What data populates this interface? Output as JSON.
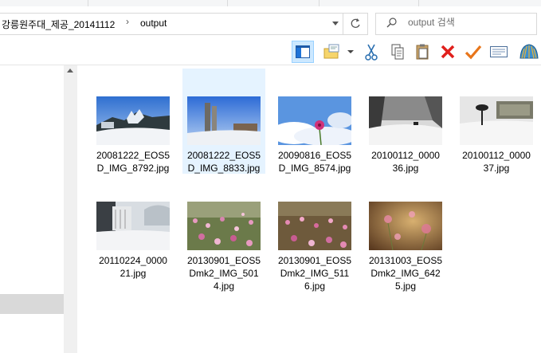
{
  "breadcrumb": {
    "items": [
      "강릉원주대_제공_20141112",
      "output"
    ],
    "separator": "›"
  },
  "search": {
    "placeholder": "output 검색"
  },
  "toolbar": {
    "buttons": [
      "preview-pane",
      "new-folder",
      "cut",
      "copy",
      "paste",
      "delete",
      "rename",
      "properties",
      "share"
    ]
  },
  "files": [
    {
      "name": "20081222_EOS5D_IMG_8792.jpg",
      "line1": "20081222_EOS5",
      "line2": "D_IMG_8792.jpg",
      "line3": "",
      "selected": false
    },
    {
      "name": "20081222_EOS5D_IMG_8833.jpg",
      "line1": "20081222_EOS5",
      "line2": "D_IMG_8833.jpg",
      "line3": "",
      "selected": true
    },
    {
      "name": "20090816_EOS5D_IMG_8574.jpg",
      "line1": "20090816_EOS5",
      "line2": "D_IMG_8574.jpg",
      "line3": "",
      "selected": false
    },
    {
      "name": "20100112_000036.jpg",
      "line1": "20100112_0000",
      "line2": "36.jpg",
      "line3": "",
      "selected": false
    },
    {
      "name": "20100112_000037.jpg",
      "line1": "20100112_0000",
      "line2": "37.jpg",
      "line3": "",
      "selected": false
    },
    {
      "name": "20110224_000021.jpg",
      "line1": "20110224_0000",
      "line2": "21.jpg",
      "line3": "",
      "selected": false
    },
    {
      "name": "20130901_EOS5Dmk2_IMG_5014.jpg",
      "line1": "20130901_EOS5",
      "line2": "Dmk2_IMG_501",
      "line3": "4.jpg",
      "selected": false
    },
    {
      "name": "20130901_EOS5Dmk2_IMG_5116.jpg",
      "line1": "20130901_EOS5",
      "line2": "Dmk2_IMG_511",
      "line3": "6.jpg",
      "selected": false
    },
    {
      "name": "20131003_EOS5Dmk2_IMG_6425.jpg",
      "line1": "20131003_EOS5",
      "line2": "Dmk2_IMG_642",
      "line3": "5.jpg",
      "selected": false
    }
  ],
  "colors": {
    "selection": "#e5f3ff",
    "accent": "#0078d7",
    "nav_selected": "#d9d9d9"
  }
}
